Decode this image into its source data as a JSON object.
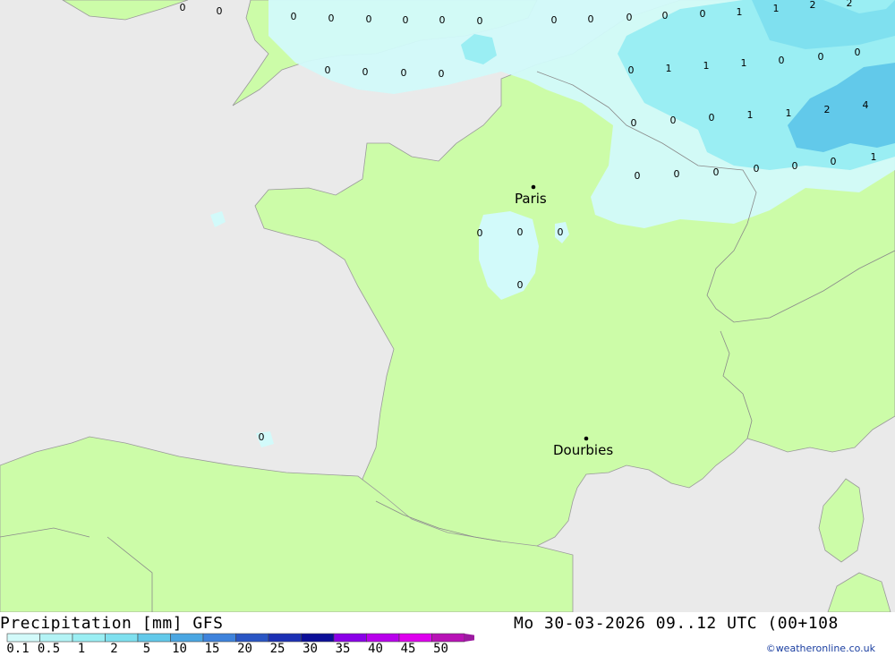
{
  "header": {
    "left_title": "Precipitation [mm] GFS",
    "right_title": "Mo 30-03-2026 09..12 UTC (00+108",
    "credit": "©weatheronline.co.uk"
  },
  "cities": [
    {
      "name": "Paris"
    },
    {
      "name": "Dourbies"
    }
  ],
  "legend": {
    "labels": [
      "0.1",
      "0.5",
      "1",
      "2",
      "5",
      "10",
      "15",
      "20",
      "25",
      "30",
      "35",
      "40",
      "45",
      "50"
    ],
    "colors": [
      "#d2fafa",
      "#b3f3f5",
      "#9aeef3",
      "#7fe0ef",
      "#62c9ea",
      "#4aa6e2",
      "#3e83dc",
      "#2a56c4",
      "#1c30b4",
      "#0c0f98",
      "#8a00e8",
      "#b800ec",
      "#de00ee",
      "#b812b6",
      "#9c1aa0"
    ]
  },
  "map_values": [
    "0",
    "0",
    "0",
    "0",
    "0",
    "0",
    "0",
    "0",
    "0",
    "0",
    "0",
    "0",
    "0",
    "1",
    "1",
    "2",
    "2",
    "0",
    "0",
    "0",
    "0",
    "0",
    "1",
    "1",
    "1",
    "0",
    "0",
    "0",
    "0",
    "0",
    "0",
    "1",
    "1",
    "2",
    "4",
    "0",
    "0",
    "0",
    "0",
    "0",
    "0",
    "1",
    "0",
    "0",
    "0",
    "0",
    "0",
    "0",
    "0"
  ],
  "colors": {
    "land": "#ccfca8",
    "sea": "#eaeaea",
    "light_precip": "#d2fafa",
    "medium_precip": "#9aeef3",
    "heavy_precip": "#62c9ea"
  }
}
